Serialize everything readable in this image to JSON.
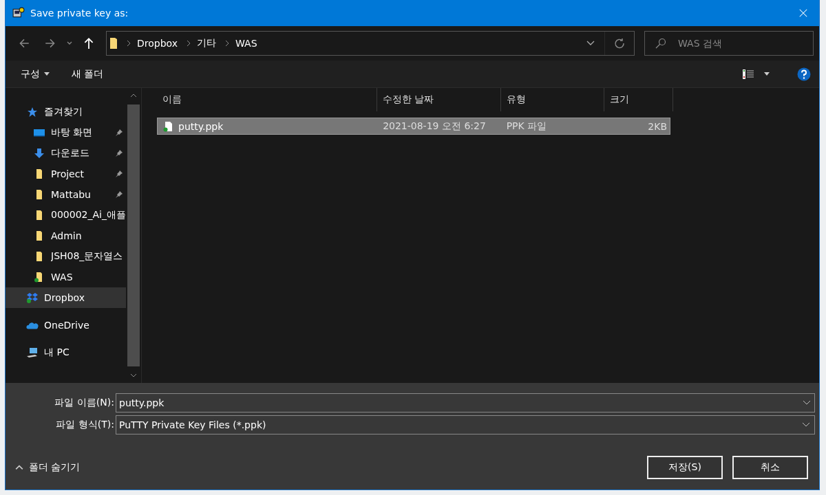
{
  "window": {
    "title": "Save private key as:"
  },
  "nav": {
    "breadcrumb": [
      "Dropbox",
      "기타",
      "WAS"
    ],
    "search": {
      "placeholder": "WAS 검색"
    }
  },
  "toolbar": {
    "organize": "구성",
    "new_folder": "새 폴더"
  },
  "sidebar": {
    "items": [
      {
        "label": "즐겨찾기",
        "kind": "star",
        "selected": false,
        "children": [
          {
            "label": "바탕 화면",
            "kind": "desktop",
            "pinned": true,
            "synced": false,
            "selected": false
          },
          {
            "label": "다운로드",
            "kind": "download",
            "pinned": true,
            "synced": false,
            "selected": false
          },
          {
            "label": "Project",
            "kind": "folder",
            "pinned": true,
            "synced": false,
            "selected": false
          },
          {
            "label": "Mattabu",
            "kind": "folder",
            "pinned": true,
            "synced": false,
            "selected": false
          },
          {
            "label": "000002_Ai_애플",
            "kind": "folder",
            "pinned": false,
            "synced": false,
            "selected": false
          },
          {
            "label": "Admin",
            "kind": "folder",
            "pinned": false,
            "synced": false,
            "selected": false
          },
          {
            "label": "JSH08_문자열스",
            "kind": "folder",
            "pinned": false,
            "synced": false,
            "selected": false
          },
          {
            "label": "WAS",
            "kind": "folder",
            "pinned": false,
            "synced": true,
            "selected": false
          }
        ]
      },
      {
        "label": "Dropbox",
        "kind": "dropbox",
        "selected": true
      },
      {
        "label": "OneDrive",
        "kind": "cloud",
        "selected": false
      },
      {
        "label": "내 PC",
        "kind": "pc",
        "selected": false
      }
    ]
  },
  "table": {
    "columns": [
      "이름",
      "수정한 날짜",
      "유형",
      "크기"
    ],
    "rows": [
      {
        "name": "putty.ppk",
        "date": "2021-08-19 오전 6:27",
        "type": "PPK 파일",
        "size": "2KB",
        "synced": true,
        "selected": true
      }
    ]
  },
  "form": {
    "file_name_label": "파일 이름(N):",
    "file_name": "putty.ppk",
    "file_type_label": "파일 형식(T):",
    "file_type": "PuTTY Private Key Files (*.ppk)"
  },
  "footer": {
    "hide_folders": "폴더 숨기기",
    "save": "저장(S)",
    "cancel": "취소"
  }
}
